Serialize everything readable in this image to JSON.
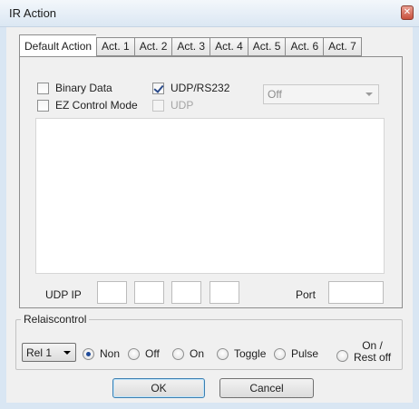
{
  "window": {
    "title": "IR Action",
    "close_glyph": "✕"
  },
  "tabs": [
    "Default Action",
    "Act. 1",
    "Act. 2",
    "Act. 3",
    "Act. 4",
    "Act. 5",
    "Act. 6",
    "Act. 7"
  ],
  "active_tab": "Default Action",
  "options": {
    "binary_data": {
      "label": "Binary Data",
      "checked": false
    },
    "ez_control": {
      "label": "EZ Control Mode",
      "checked": false
    },
    "udp_rs232": {
      "label": "UDP/RS232",
      "checked": true
    },
    "udp": {
      "label": "UDP",
      "checked": false,
      "disabled": true
    }
  },
  "mode_select": {
    "value": "Off",
    "disabled": true
  },
  "data_text": "",
  "udp": {
    "ip_label": "UDP IP",
    "ip_octets": [
      "",
      "",
      "",
      ""
    ],
    "port_label": "Port",
    "port_value": ""
  },
  "relais": {
    "legend": "Relaiscontrol",
    "select_value": "Rel 1",
    "radios": [
      {
        "label": "Non",
        "selected": true
      },
      {
        "label": "Off",
        "selected": false
      },
      {
        "label": "On",
        "selected": false
      },
      {
        "label": "Toggle",
        "selected": false
      },
      {
        "label": "Pulse",
        "selected": false
      },
      {
        "label": "On /",
        "label2": "Rest off",
        "selected": false
      }
    ]
  },
  "buttons": {
    "ok": "OK",
    "cancel": "Cancel"
  },
  "colors": {
    "title_bar": "#dbe7f3",
    "close": "#c8503c",
    "selected_radio": "#1f4b9a"
  }
}
